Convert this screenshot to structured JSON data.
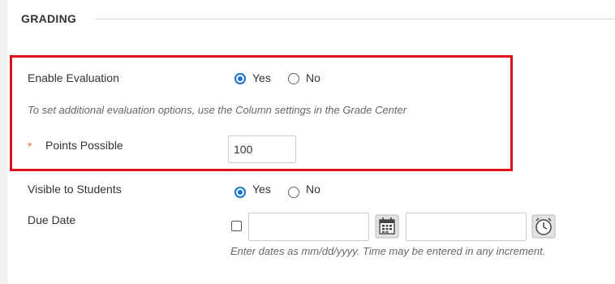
{
  "section": {
    "title": "GRADING"
  },
  "enable_evaluation": {
    "label": "Enable Evaluation",
    "options": [
      {
        "label": "Yes",
        "selected": true
      },
      {
        "label": "No",
        "selected": false
      }
    ],
    "hint": "To set additional evaluation options, use the Column settings in the Grade Center"
  },
  "points_possible": {
    "required_marker": "*",
    "label": "Points Possible",
    "value": "100"
  },
  "visible_to_students": {
    "label": "Visible to Students",
    "options": [
      {
        "label": "Yes",
        "selected": true
      },
      {
        "label": "No",
        "selected": false
      }
    ]
  },
  "due_date": {
    "label": "Due Date",
    "checked": false,
    "date_value": "",
    "time_value": "",
    "hint": "Enter dates as mm/dd/yyyy. Time may be entered in any increment."
  },
  "icons": {
    "calendar": "calendar-icon",
    "clock": "clock-icon"
  },
  "colors": {
    "highlight_border": "#e0101a",
    "radio_selected": "#1a73c8",
    "required_star": "#d8762f"
  }
}
